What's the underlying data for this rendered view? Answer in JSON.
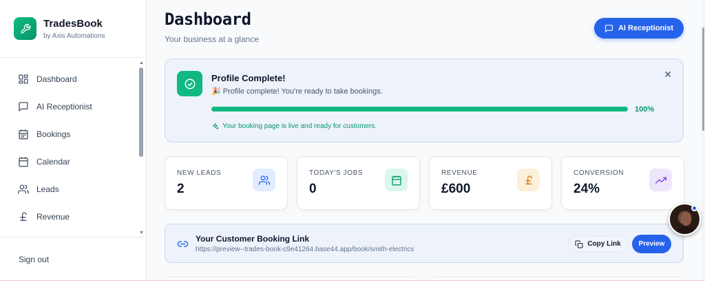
{
  "brand": {
    "name": "TradesBook",
    "subtitle": "by Axis Automations"
  },
  "sidebar": {
    "items": [
      {
        "label": "Dashboard",
        "icon": "dashboard-icon"
      },
      {
        "label": "AI Receptionist",
        "icon": "message-square-icon"
      },
      {
        "label": "Bookings",
        "icon": "calendar-days-icon"
      },
      {
        "label": "Calendar",
        "icon": "calendar-icon"
      },
      {
        "label": "Leads",
        "icon": "users-icon"
      },
      {
        "label": "Revenue",
        "icon": "pound-icon"
      }
    ],
    "sign_out": "Sign out"
  },
  "header": {
    "title": "Dashboard",
    "subtitle": "Your business at a glance",
    "ai_button": "AI Receptionist"
  },
  "profile": {
    "title": "Profile Complete!",
    "message": "🎉 Profile complete! You're ready to take bookings.",
    "progress": 100,
    "progress_label": "100%",
    "live_text": "Your booking page is live and ready for customers."
  },
  "stats": [
    {
      "label": "NEW LEADS",
      "value": "2",
      "icon": "users-icon",
      "color": "#2563eb",
      "bg": "#e0ecff"
    },
    {
      "label": "TODAY'S JOBS",
      "value": "0",
      "icon": "calendar-icon",
      "color": "#059669",
      "bg": "#d9f7ea"
    },
    {
      "label": "REVENUE",
      "value": "£600",
      "icon": "pound-icon",
      "color": "#d97706",
      "bg": "#fdf0d9"
    },
    {
      "label": "CONVERSION",
      "value": "24%",
      "icon": "trending-up-icon",
      "color": "#7c3aed",
      "bg": "#ede6fb"
    }
  ],
  "booking_link": {
    "title": "Your Customer Booking Link",
    "url": "https://preview--trades-book-c9e41264.base44.app/book/smith-electrics",
    "copy_label": "Copy Link",
    "preview_label": "Preview"
  },
  "colors": {
    "primary": "#2563eb",
    "success": "#10b981"
  }
}
